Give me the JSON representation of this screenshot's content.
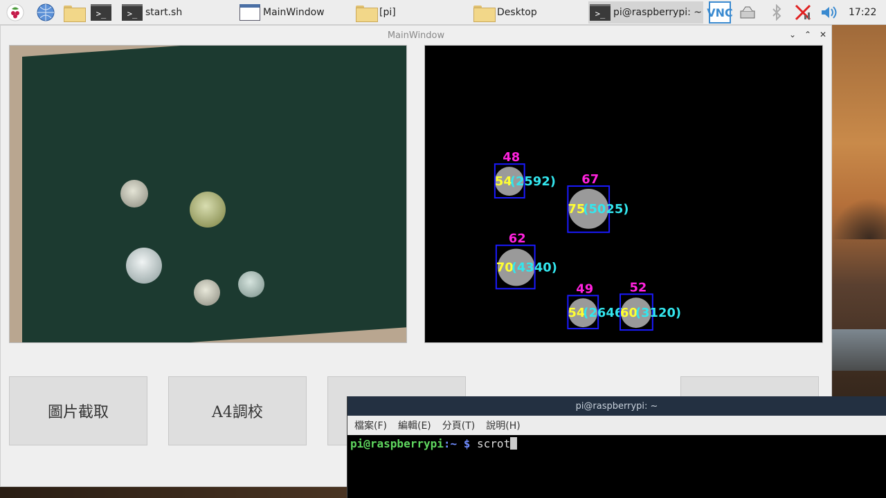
{
  "taskbar": {
    "tasks": [
      {
        "label": "start.sh",
        "icon": "terminal-icon"
      },
      {
        "label": "MainWindow",
        "icon": "window-icon"
      },
      {
        "label": "[pi]",
        "icon": "folder-icon"
      },
      {
        "label": "Desktop",
        "icon": "folder-icon"
      },
      {
        "label": "pi@raspberrypi: ~",
        "icon": "terminal-icon"
      }
    ],
    "clock": "17:22",
    "tray": {
      "vnc_icon": "VNC"
    }
  },
  "main_window": {
    "title": "MainWindow",
    "buttons": {
      "capture": "圖片截取",
      "calibrate": "A4調校"
    },
    "detections": [
      {
        "top": "48",
        "left": "54",
        "right": "(2592)"
      },
      {
        "top": "67",
        "left": "75",
        "right": "(5025)"
      },
      {
        "top": "62",
        "left": "70",
        "right": "(4340)"
      },
      {
        "top": "49",
        "left": "54",
        "right": "(2646"
      },
      {
        "top": "52",
        "left": "60",
        "right": "(3120)"
      }
    ]
  },
  "terminal": {
    "title": "pi@raspberrypi: ~",
    "menu": [
      "檔案(F)",
      "編輯(E)",
      "分頁(T)",
      "說明(H)"
    ],
    "prompt_user": "pi@raspberrypi",
    "prompt_sep": ":~ $",
    "command": "scrot"
  },
  "colors": {
    "detect_box": "#1a1aff",
    "label_top": "#ff22dd",
    "label_left": "#ffff33",
    "label_right": "#33e6ee",
    "coin_fill": "#9a9a9a"
  }
}
